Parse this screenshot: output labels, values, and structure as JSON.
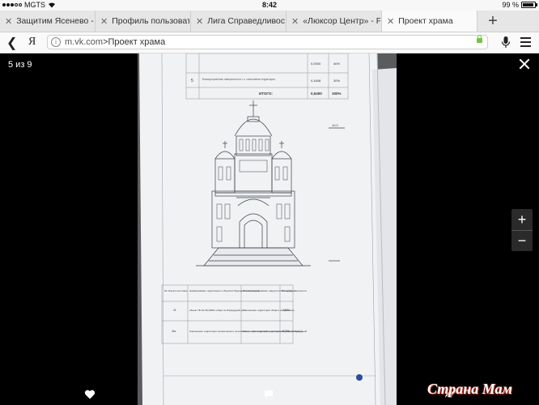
{
  "status": {
    "carrier": "MGTS",
    "time": "8:42",
    "battery": "99 %"
  },
  "tabs": [
    {
      "title": "Защитим Ясенево - М",
      "active": false
    },
    {
      "title": "Профиль пользовател",
      "active": false
    },
    {
      "title": "Лига Справедливости",
      "active": false
    },
    {
      "title": "«Люксор Центр» - Ре",
      "active": false
    },
    {
      "title": "Проект храма",
      "active": true
    }
  ],
  "address": {
    "domain": "m.vk.com",
    "separator": " > ",
    "page": "Проект храма",
    "logo": "Я"
  },
  "viewer": {
    "counter": "5 из 9",
    "zoom_in": "+",
    "zoom_out": "−"
  },
  "document": {
    "top_table": {
      "row_number": "5",
      "row_text": "Благоустроенные поверхности и т.ч. озеленения территории",
      "row_area": "0,1608",
      "row_percent": "30%",
      "upper_area": "0,0000",
      "upper_percent": "40%",
      "total_label": "ИТОГО:",
      "total_area": "0,5400",
      "total_percent": "100%"
    },
    "bottom_table": {
      "headers": [
        "№ объекта на плане",
        "Наименование территории и объектов Природного комплекса",
        "Режим регулирования градостроительной деятельности",
        "Площадь, га"
      ],
      "rows": [
        {
          "num": "41",
          "name": "объект ПК № 65-СВАО «Парк по Изумрудной ул.»",
          "mode": "Озеленение территории общего пользования",
          "area": "3,600"
        },
        {
          "num": "41a",
          "name": "Озеленение территории ограниченного пользования – прилегающей территории за улицей Изумрудной",
          "mode": "Озеленение территории ограниченного пользования",
          "area": "0,740"
        }
      ]
    }
  },
  "icons": {
    "like": "heart-icon",
    "comment": "comment-icon",
    "share": "share-icon"
  },
  "watermark": "Страна Мам"
}
